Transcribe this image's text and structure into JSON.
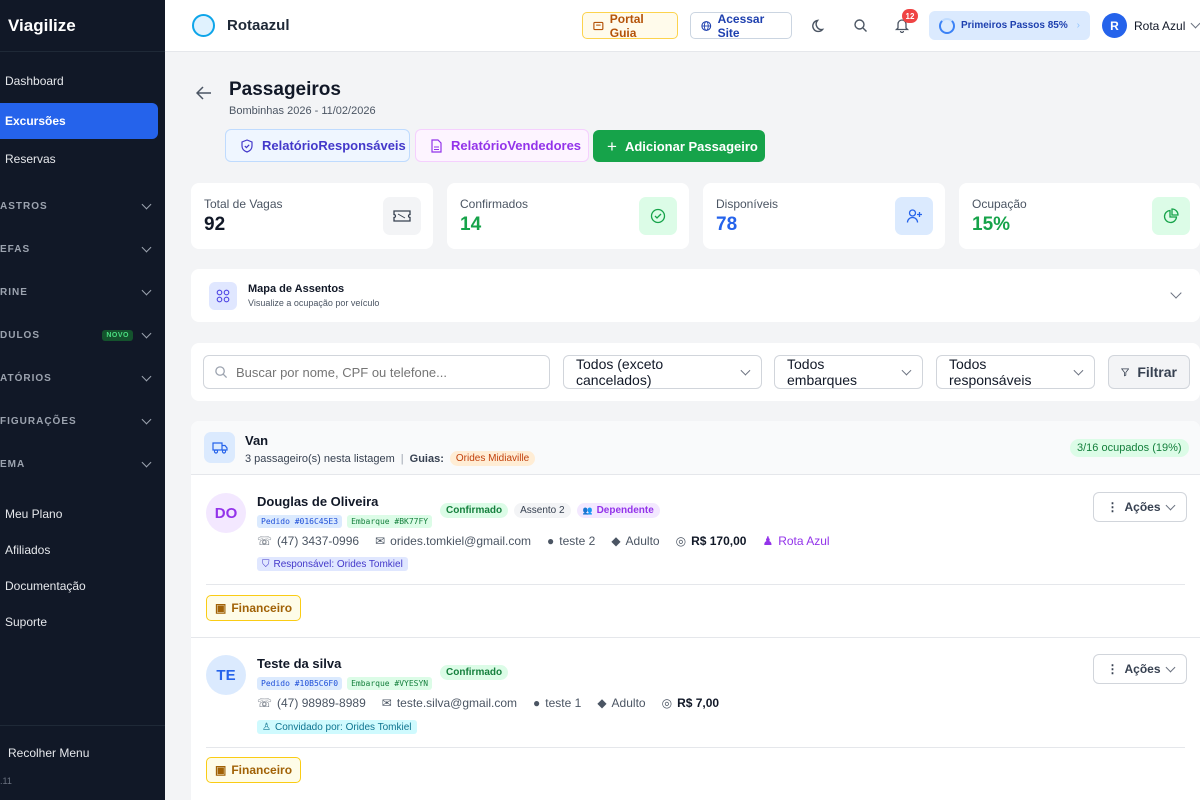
{
  "sidebar": {
    "brand": "Viagilize",
    "items": [
      {
        "label": "Dashboard"
      },
      {
        "label": "Excursões"
      },
      {
        "label": "Reservas"
      }
    ],
    "sections": [
      {
        "label": "ASTROS"
      },
      {
        "label": "EFAS"
      },
      {
        "label": "RINE"
      },
      {
        "label": "DULOS",
        "badge": "NOVO"
      },
      {
        "label": "ATÓRIOS"
      },
      {
        "label": "FIGURAÇÕES"
      },
      {
        "label": "EMA"
      }
    ],
    "links": [
      {
        "label": "Meu Plano"
      },
      {
        "label": "Afiliados"
      },
      {
        "label": "Documentação"
      },
      {
        "label": "Suporte"
      }
    ],
    "collapse_label": "Recolher Menu",
    "version": ".11"
  },
  "topbar": {
    "company": "Rotaazul",
    "portal_label": "Portal Guia",
    "site_label": "Acessar Site",
    "notifications_count": "12",
    "onboarding_label": "Primeiros Passos 85%",
    "user_initial": "R",
    "user_name": "Rota Azul"
  },
  "page": {
    "title": "Passageiros",
    "subtitle": "Bombinhas 2026 - 11/02/2026",
    "actions": {
      "rel_responsaveis": "RelatórioResponsáveis",
      "rel_vendedores": "RelatórioVendedores",
      "add_passenger": "Adicionar Passageiro"
    }
  },
  "stats": [
    {
      "label": "Total de Vagas",
      "value": "92",
      "color": "#111827"
    },
    {
      "label": "Confirmados",
      "value": "14",
      "color": "#16a34a"
    },
    {
      "label": "Disponíveis",
      "value": "78",
      "color": "#2563eb"
    },
    {
      "label": "Ocupação",
      "value": "15%",
      "color": "#16a34a"
    }
  ],
  "seat_map": {
    "title": "Mapa de Assentos",
    "subtitle": "Visualize a ocupação por veículo"
  },
  "filters": {
    "search_placeholder": "Buscar por nome, CPF ou telefone...",
    "status": "Todos (exceto cancelados)",
    "boarding": "Todos embarques",
    "responsible": "Todos responsáveis",
    "filter_button": "Filtrar"
  },
  "vehicle": {
    "name": "Van",
    "count_text": "3 passageiro(s) nesta listagem",
    "guides_label": "Guias:",
    "guide": "Orides Midiaville",
    "occupancy": "3/16 ocupados (19%)"
  },
  "passengers": [
    {
      "initials": "DO",
      "name": "Douglas de Oliveira",
      "status": "Confirmado",
      "seat": "Assento 2",
      "type_badge": "Dependente",
      "order": "Pedido #016C45E3",
      "boarding": "Embarque #BK77FY",
      "phone": "(47) 3437-0996",
      "email": "orides.tomkiel@gmail.com",
      "location": "teste 2",
      "category": "Adulto",
      "price": "R$ 170,00",
      "seller": "Rota Azul",
      "relation": "Responsável: Orides Tomkiel",
      "actions_label": "Ações",
      "finance_label": "Financeiro"
    },
    {
      "initials": "TE",
      "name": "Teste da silva",
      "status": "Confirmado",
      "order": "Pedido #10B5C6F0",
      "boarding": "Embarque #VYESYN",
      "phone": "(47) 98989-8989",
      "email": "teste.silva@gmail.com",
      "location": "teste 1",
      "category": "Adulto",
      "price": "R$ 7,00",
      "relation": "Convidado por: Orides Tomkiel",
      "actions_label": "Ações",
      "finance_label": "Financeiro"
    }
  ]
}
